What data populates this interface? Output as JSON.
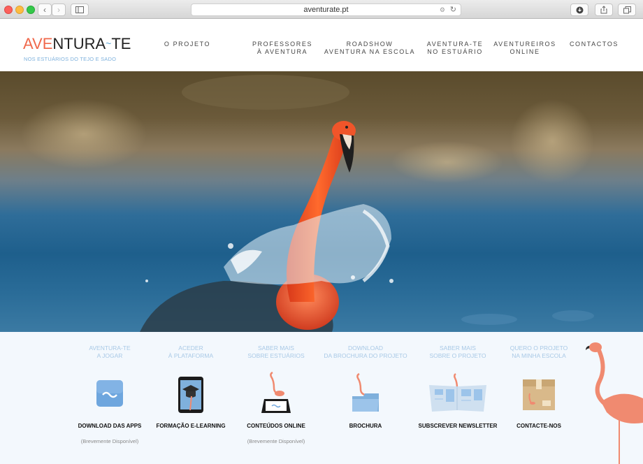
{
  "browser": {
    "url": "aventurate.pt"
  },
  "logo": {
    "ave": "AVE",
    "rest1": "NTURA",
    "tilde": "~",
    "rest2": "TE",
    "tagline": "NOS ESTUÁRIOS DO TEJO E SADO"
  },
  "nav": [
    {
      "line1": "O PROJETO",
      "line2": ""
    },
    {
      "line1": "PROFESSORES",
      "line2": "À AVENTURA"
    },
    {
      "line1": "ROADSHOW",
      "line2": "AVENTURA NA ESCOLA"
    },
    {
      "line1": "AVENTURA-TE",
      "line2": "NO ESTUÁRIO"
    },
    {
      "line1": "AVENTUREIROS",
      "line2": "ONLINE"
    },
    {
      "line1": "CONTACTOS",
      "line2": ""
    }
  ],
  "tiles": [
    {
      "top1": "AVENTURA-TE",
      "top2": "A JOGAR",
      "label": "DOWNLOAD DAS APPS",
      "note": "(Brevemente Disponível)",
      "icon": "app-icon"
    },
    {
      "top1": "ACEDER",
      "top2": "À PLATAFORMA",
      "label": "FORMAÇÃO E-LEARNING",
      "note": "",
      "icon": "tablet-graduation-icon"
    },
    {
      "top1": "SABER MAIS",
      "top2": "SOBRE ESTUÁRIOS",
      "label": "CONTEÚDOS ONLINE",
      "note": "(Brevemente Disponível)",
      "icon": "flamingo-tablet-icon"
    },
    {
      "top1": "DOWNLOAD",
      "top2": "DA BROCHURA DO PROJETO",
      "label": "BROCHURA",
      "note": "",
      "icon": "folder-icon"
    },
    {
      "top1": "SABER MAIS",
      "top2": "SOBRE O PROJETO",
      "label": "SUBSCREVER NEWSLETTER",
      "note": "",
      "icon": "newspaper-icon"
    },
    {
      "top1": "QUERO O PROJETO",
      "top2": "NA MINHA ESCOLA",
      "label": "CONTACTE-NOS",
      "note": "",
      "icon": "box-icon"
    }
  ],
  "colors": {
    "accent": "#f0684b",
    "blue": "#5aa7d8",
    "tile_bg": "#f3f8fd"
  }
}
